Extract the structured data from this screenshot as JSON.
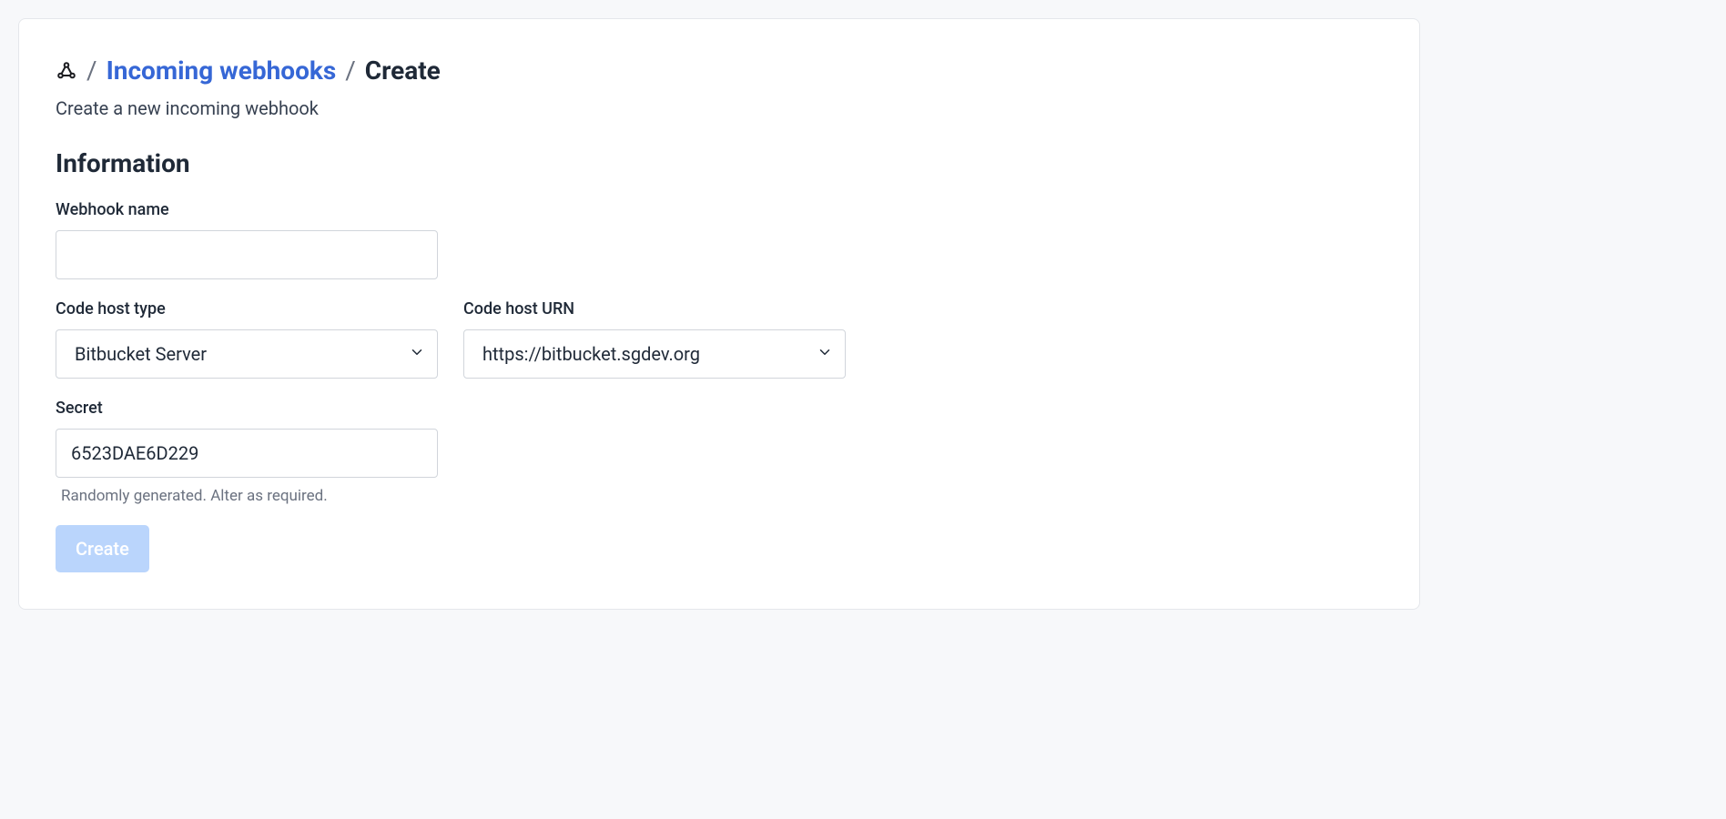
{
  "breadcrumb": {
    "separator": "/",
    "link_label": "Incoming webhooks",
    "current": "Create"
  },
  "subtitle": "Create a new incoming webhook",
  "section_heading": "Information",
  "form": {
    "name": {
      "label": "Webhook name",
      "value": ""
    },
    "code_host_type": {
      "label": "Code host type",
      "selected": "Bitbucket Server"
    },
    "code_host_urn": {
      "label": "Code host URN",
      "selected": "https://bitbucket.sgdev.org"
    },
    "secret": {
      "label": "Secret",
      "value": "6523DAE6D229",
      "help": "Randomly generated. Alter as required."
    }
  },
  "actions": {
    "create_label": "Create"
  }
}
